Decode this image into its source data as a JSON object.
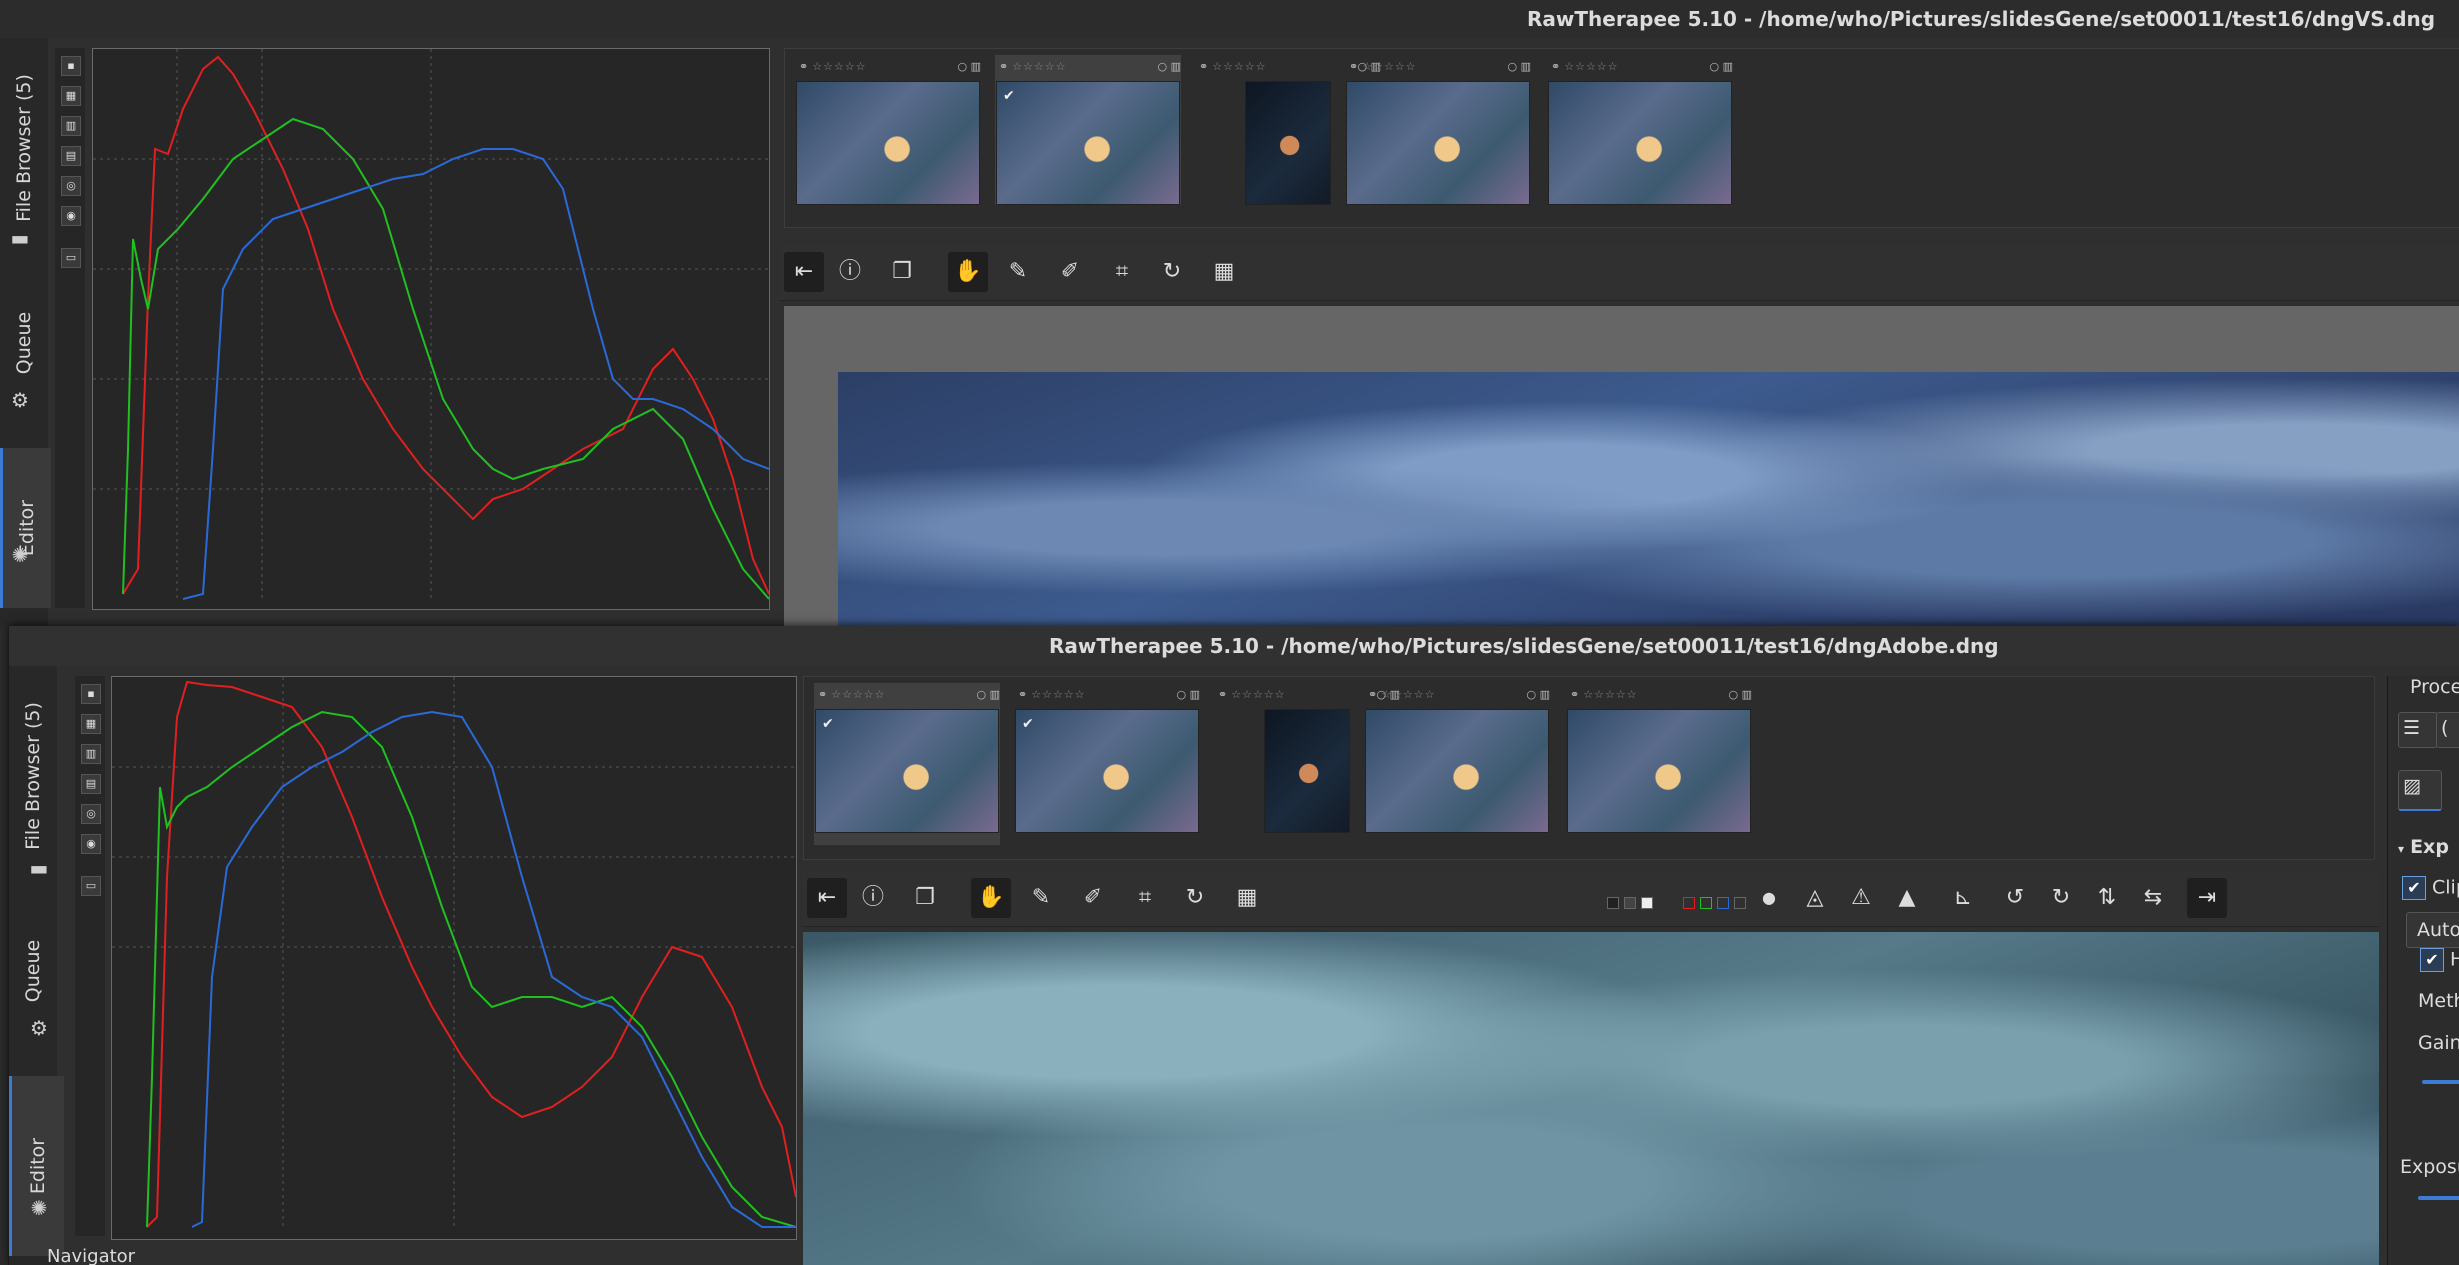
{
  "window1": {
    "title": "RawTherapee 5.10 - /home/who/Pictures/slidesGene/set00011/test16/dngVS.dng",
    "vtabs": {
      "file_browser": "File Browser (5)",
      "queue": "Queue",
      "editor": "Editor"
    }
  },
  "window2": {
    "title": "RawTherapee 5.10 - /home/who/Pictures/slidesGene/set00011/test16/dngAdobe.dng",
    "vtabs": {
      "file_browser": "File Browser (5)",
      "queue": "Queue",
      "editor": "Editor"
    },
    "navigator_label": "Navigator",
    "right_panel": {
      "section_partial": "Proces",
      "exposure_header": "Exp",
      "clip_label": "Clip",
      "auto_button": "Auto",
      "h_label": "H",
      "method_label": "Metho",
      "gain_label": "Gain",
      "exposure_label": "Exposu"
    }
  },
  "thumbnail": {
    "stars": "☆☆☆☆☆"
  },
  "icons": {
    "hide_toolbar": "panel-left-icon",
    "info": "info-icon",
    "before_after": "before-after-icon",
    "hand": "hand-icon",
    "color_picker": "eyedropper-icon",
    "spot": "spot-removal-icon",
    "crop": "crop-icon",
    "rotate": "rotate-icon",
    "perspective": "perspective-icon"
  },
  "colors": {
    "accent": "#3d7bd4",
    "red": "#e02020",
    "green": "#20c020",
    "blue": "#2a6ad8"
  }
}
